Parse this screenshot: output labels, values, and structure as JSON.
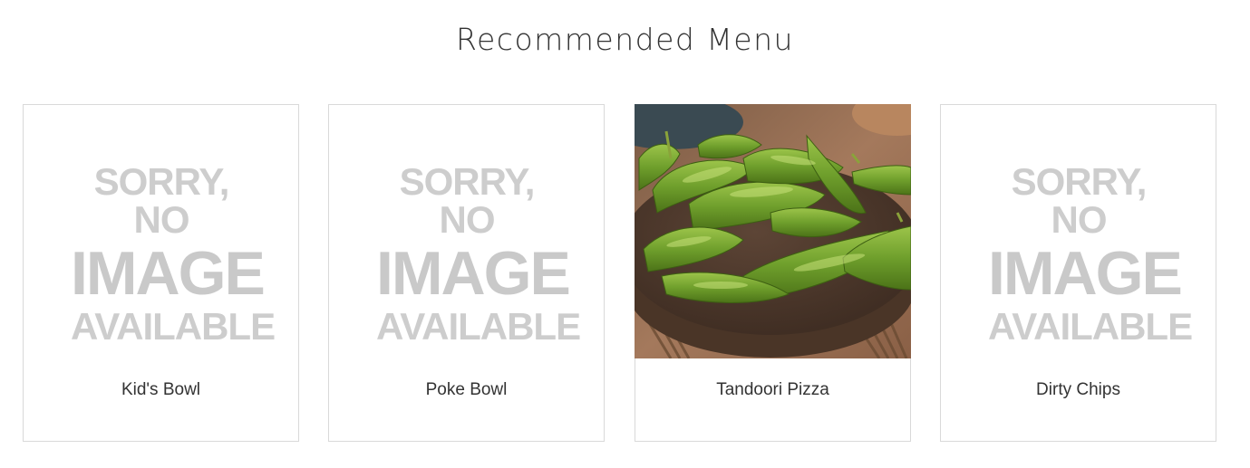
{
  "section": {
    "title": "Recommended Menu"
  },
  "placeholder": {
    "line1": "SORRY, NO",
    "line2": "IMAGE",
    "line3": "AVAILABLE"
  },
  "items": [
    {
      "name": "Kid's Bowl",
      "has_image": false
    },
    {
      "name": "Poke Bowl",
      "has_image": false
    },
    {
      "name": "Tandoori Pizza",
      "has_image": true,
      "image_subject": "edamame pods in a brown ceramic bowl"
    },
    {
      "name": "Dirty Chips",
      "has_image": false
    }
  ],
  "colors": {
    "border": "#d9d9d9",
    "text": "#333333",
    "placeholder_text": "#cdcdcd"
  }
}
